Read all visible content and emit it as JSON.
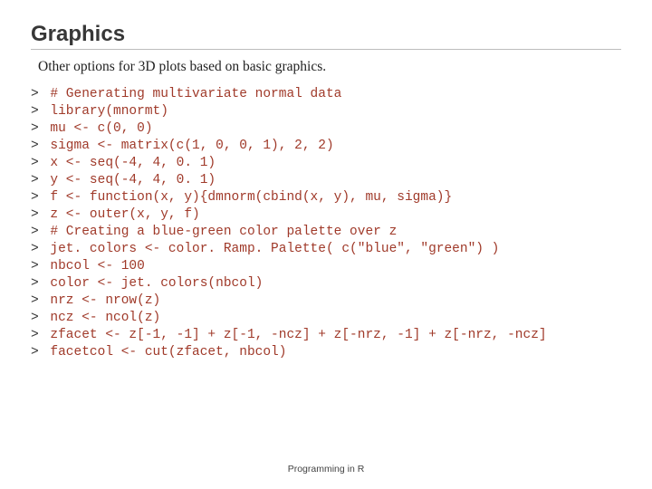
{
  "title": "Graphics",
  "subtitle": "Other options for 3D plots based on basic graphics.",
  "code_lines": [
    "# Generating multivariate normal data",
    "library(mnormt)",
    "mu <- c(0, 0)",
    "sigma <- matrix(c(1, 0, 0, 1), 2, 2)",
    "x <- seq(-4, 4, 0. 1)",
    "y <- seq(-4, 4, 0. 1)",
    "f <- function(x, y){dmnorm(cbind(x, y), mu, sigma)}",
    "z <- outer(x, y, f)",
    "# Creating a blue-green color palette over z",
    "jet. colors <- color. Ramp. Palette( c(\"blue\", \"green\") )",
    "nbcol <- 100",
    "color <- jet. colors(nbcol)",
    "nrz <- nrow(z)",
    "ncz <- ncol(z)",
    "zfacet <- z[-1, -1] + z[-1, -ncz] + z[-nrz, -1] + z[-nrz, -ncz]",
    "facetcol <- cut(zfacet, nbcol)"
  ],
  "prompt": ">",
  "footer": "Programming in R"
}
